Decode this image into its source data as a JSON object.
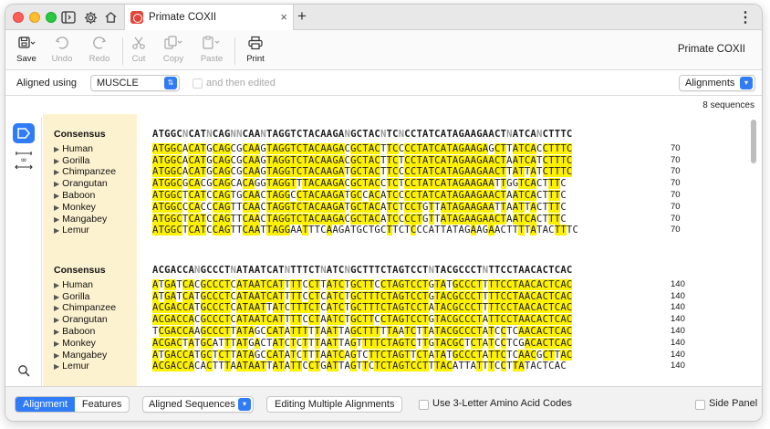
{
  "tab": {
    "title": "Primate COXII",
    "close": "×",
    "new": "+"
  },
  "menu": "⋮",
  "toolbar": {
    "buttons": [
      {
        "label": "Save"
      },
      {
        "label": "Undo"
      },
      {
        "label": "Redo"
      },
      {
        "label": "Cut"
      },
      {
        "label": "Copy"
      },
      {
        "label": "Paste"
      },
      {
        "label": "Print"
      }
    ],
    "doc_title": "Primate COXII"
  },
  "options": {
    "aligned_using_label": "Aligned using",
    "aligner": "MUSCLE",
    "edited_label": "and then edited",
    "view_select": "Alignments"
  },
  "sequence_count": "8 sequences",
  "blocks": [
    {
      "consensus_label": "Consensus",
      "consensus": "ATGGCNCATNCAGNNCAANTAGGTCTACAAGANGCTACNTCNCCTATCATAGAAGAACTNATCANCTTTC",
      "end": "70",
      "rows": [
        {
          "name": "Human",
          "seq": "ATGGCACATGCAGCGCAAGTAGGTCTACAAGACGCTACTTCCCCTATCATAGAAGAGCTTATCACCTTTC"
        },
        {
          "name": "Gorilla",
          "seq": "ATGGCACATGCAGCGCAAGTAGGTCTACAAGACGCTACTTCTCCTATCATAGAAGAACTAATCATCTTTC"
        },
        {
          "name": "Chimpanzee",
          "seq": "ATGGCACATGCAGCGCAAGTAGGTCTACAAGATGCTACTTCCCCTATCATAGAAGAACTTATTATCTTTC"
        },
        {
          "name": "Orangutan",
          "seq": "ATGGCGCACGCAGCACAGGTAGGTTTACAAGACGCTACCTCTCCTATCATAGAAGAATTGGTCACTTTC"
        },
        {
          "name": "Baboon",
          "seq": "ATGGCTCATCCAGTGCAACTAGGCCTACAAGATGCCACATCCCCTATCATAGAAGAACTAATCACTTTC"
        },
        {
          "name": "Monkey",
          "seq": "ATGGCCCACCCAGTTCAACTAGGTCTACAAGATGCTACATCTCCTGTTATAGAAGAATTAATTACTTTC"
        },
        {
          "name": "Mangabey",
          "seq": "ATGGCTCATCCAGTTCAACTAGGTCTACAAGACGCTACATCCCCTGTTATAGAAGAACTAATCACTTTC"
        },
        {
          "name": "Lemur",
          "seq": "ATGGCTCATCCAGTTCAATTAGGAATTTCAAGATGCTGCTTCTCCCATTATAGAAGAACTTTTATACTTTC"
        }
      ]
    },
    {
      "consensus_label": "Consensus",
      "consensus": "ACGACCANGCCCTNATAATCATNTTTCTNATCNGCTTTCTAGTCCTNTACGCCCTNTTCCTAACACTCAC",
      "end": "140",
      "rows": [
        {
          "name": "Human",
          "seq": "ATGATCACGCCCTCATAATCATTTTCCTTATCTGCTTCCTAGTCCTGTATGCCCTTTTCCTAACACTCAC"
        },
        {
          "name": "Gorilla",
          "seq": "ATGATCATGCCCTCATAATCATTTTCCTCATCTGCTTTCTAGTCCTGTACGCCCTTTTCCTAACACTCAC"
        },
        {
          "name": "Chimpanzee",
          "seq": "ACGACCATGCCCTCATAATTATCTTTCTCATCTGCTTTCTAGTCCTATACGCCCTTTTCCTAACACTCAC"
        },
        {
          "name": "Orangutan",
          "seq": "ACGACCACGCCCTCATAATCATTTTCCTAATCTGCTTCCTAGTCCTGTACGCCCTATTCCTAACACTCAC"
        },
        {
          "name": "Baboon",
          "seq": "TCGACCAAGCCCTTATAGCCATATTTTTAATTAGCTTTTTAATCTTATACGCCCTATCCTCAACACTCAC"
        },
        {
          "name": "Monkey",
          "seq": "ACGACTATGCATTTATGACTATCTCTTTAATTAGTTTTCTAGTCTTGTACGCTCTATCCTCGACACTCAC"
        },
        {
          "name": "Mangabey",
          "seq": "ATGACCATGCTCTTATAGCCATATCTTTAATCAGTCTTCTAGTTCTATATGCCCTATTCTCAACGCTTAC"
        },
        {
          "name": "Lemur",
          "seq": "ACGACCACACTTTAATAATTATATTCCTGATTAGTTCTCTAGTCCTTTACATTATTTCCTTATACTCAC"
        }
      ]
    }
  ],
  "bottom": {
    "seg_alignment": "Alignment",
    "seg_features": "Features",
    "view_select": "Aligned Sequences",
    "editing_button": "Editing Multiple Alignments",
    "three_letter_label": "Use 3-Letter Amino Acid Codes",
    "side_panel_label": "Side Panel"
  },
  "colors": {
    "highlight": "#fff200",
    "names_bg": "#fdf2d0",
    "accent": "#2f7cf6"
  }
}
